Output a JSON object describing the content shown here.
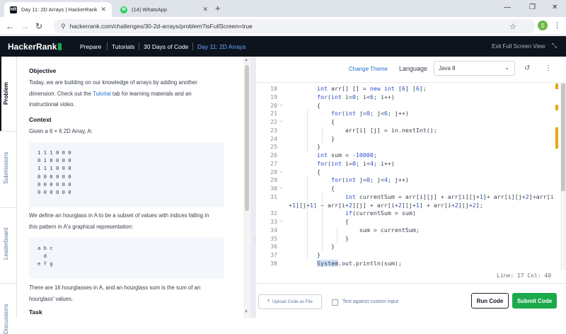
{
  "browser": {
    "tabs": [
      {
        "label": "Day 11: 2D Arrays | HackerRank",
        "favicon": "HR",
        "favicon_color": "#0e141e"
      },
      {
        "label": "(14) WhatsApp",
        "favicon": "W",
        "favicon_color": "#25d366"
      }
    ],
    "url": "hackerrank.com/challenges/30-2d-arrays/problem?isFullScreen=true",
    "profile_initial": "S"
  },
  "header": {
    "logo": "HackerRank",
    "nav": [
      "Prepare",
      "Tutorials",
      "30 Days of Code",
      "Day 11: 2D Arrays"
    ],
    "exit_label": "Exit Full Screen View"
  },
  "side_tabs": [
    "Problem",
    "Submissions",
    "Leaderboard",
    "Discussions"
  ],
  "problem": {
    "objective_heading": "Objective",
    "objective_text_1": "Today, we are building on our knowledge of arrays by adding another",
    "objective_text_2": "dimension. Check out the ",
    "tutorial_link": "Tutorial",
    "objective_text_3": " tab for learning materials and an",
    "objective_text_4": "instructional video.",
    "context_heading": "Context",
    "context_text": "Given a 6 × 6 2D Array, A:",
    "array_rows": [
      "1 1 1 0 0 0",
      "0 1 0 0 0 0",
      "1 1 1 0 0 0",
      "0 0 0 0 0 0",
      "0 0 0 0 0 0",
      "0 0 0 0 0 0"
    ],
    "hourglass_text_1": "We define an hourglass in A to be a subset of values with indices falling in",
    "hourglass_text_2": "this pattern in A's graphical representation:",
    "pattern_rows": [
      "a b c",
      "  d",
      "e f g"
    ],
    "count_text_1": "There are 16 hourglasses in A, and an hourglass sum is the sum of an",
    "count_text_2": "hourglass' values.",
    "task_heading": "Task"
  },
  "editor": {
    "change_theme": "Change Theme",
    "language_label": "Language",
    "language_value": "Java 8",
    "status": "Line: 17  Col: 40",
    "upload_label": "Upload Code as File",
    "custom_input_label": "Test against custom input",
    "run_label": "Run Code",
    "submit_label": "Submit Code",
    "lines": [
      {
        "num": "18",
        "fold": false,
        "text": "        int arr[] [] = new int [6] [6];"
      },
      {
        "num": "19",
        "fold": false,
        "text": "        for(int i=0; i<6; i++)"
      },
      {
        "num": "20",
        "fold": true,
        "text": "        {"
      },
      {
        "num": "21",
        "fold": false,
        "text": "            for(int j=0; j<6; j++)"
      },
      {
        "num": "22",
        "fold": true,
        "text": "            {"
      },
      {
        "num": "23",
        "fold": false,
        "text": "                arr[i] [j] = in.nextInt();"
      },
      {
        "num": "24",
        "fold": false,
        "text": "            }"
      },
      {
        "num": "25",
        "fold": false,
        "text": "        }"
      },
      {
        "num": "26",
        "fold": false,
        "text": "        int sum = -10000;"
      },
      {
        "num": "27",
        "fold": false,
        "text": "        for(int i=0; i<4; i++)"
      },
      {
        "num": "28",
        "fold": true,
        "text": "        {"
      },
      {
        "num": "29",
        "fold": false,
        "text": "            for(int j=0; j<4; j++)"
      },
      {
        "num": "30",
        "fold": true,
        "text": "            {"
      },
      {
        "num": "31",
        "fold": false,
        "text": "                int currentSum = arr[i][j] + arr[i][j+1]+ arr[i][j+2]+arr[i"
      },
      {
        "num": "",
        "fold": false,
        "text": "+1][j+1] + arr[i+2][j] + arr[i+2][j+1] + arr[i+2][j+2];"
      },
      {
        "num": "32",
        "fold": false,
        "text": "                if(currentSum > sum)"
      },
      {
        "num": "33",
        "fold": true,
        "text": "                {"
      },
      {
        "num": "34",
        "fold": false,
        "text": "                    sum = currentSum;"
      },
      {
        "num": "35",
        "fold": false,
        "text": "                }"
      },
      {
        "num": "36",
        "fold": false,
        "text": "            }"
      },
      {
        "num": "37",
        "fold": false,
        "text": "        }"
      },
      {
        "num": "38",
        "fold": false,
        "text": "        System.out.println(sum);"
      }
    ]
  },
  "colors": {
    "header_bg": "#0e141e",
    "accent_green": "#1ba94c",
    "link_blue": "#1f6fd0",
    "keyword_blue": "#2a4fd1"
  }
}
